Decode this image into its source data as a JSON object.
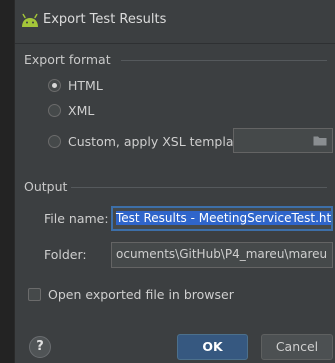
{
  "window": {
    "title": "Export Test Results"
  },
  "export_format": {
    "section_label": "Export format",
    "options": [
      {
        "label": "HTML",
        "selected": true
      },
      {
        "label": "XML",
        "selected": false
      },
      {
        "label": "Custom, apply XSL template:",
        "selected": false
      }
    ],
    "template_path": ""
  },
  "output": {
    "section_label": "Output",
    "file_name_label": "File name:",
    "file_name_value": "Test Results - MeetingServiceTest.html",
    "folder_label": "Folder:",
    "folder_value": "ocuments\\GitHub\\P4_mareu\\mareu"
  },
  "open_in_browser": {
    "label": "Open exported file in browser",
    "checked": false
  },
  "buttons": {
    "help": "?",
    "ok": "OK",
    "cancel": "Cancel"
  },
  "colors": {
    "background": "#3c3f41",
    "accent": "#365880",
    "selection": "#2f65ca",
    "android_green": "#a4c639"
  },
  "icons": {
    "app": "android-icon",
    "browse": "folder-icon"
  }
}
